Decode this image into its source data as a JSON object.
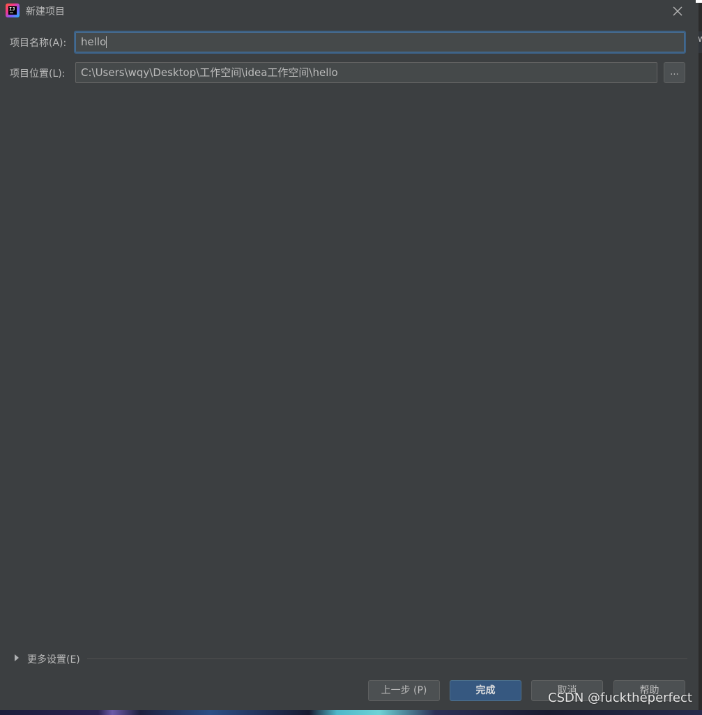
{
  "window": {
    "title": "新建项目",
    "icon": "intellij-idea-icon"
  },
  "form": {
    "name_label": "项目名称(A):",
    "name_value": "hello",
    "location_label": "项目位置(L):",
    "location_value": "C:\\Users\\wqy\\Desktop\\工作空间\\idea工作空间\\hello",
    "browse_label": "..."
  },
  "more_settings": {
    "label": "更多设置(E)",
    "expanded": false
  },
  "buttons": {
    "previous": "上一步 (P)",
    "finish": "完成",
    "cancel": "取消",
    "help": "帮助"
  },
  "watermark": "CSDN @fucktheperfect",
  "colors": {
    "background": "#3c3f41",
    "field_background": "#45494a",
    "focus_border": "#3d6185",
    "primary_button": "#365880",
    "text": "#bbbbbb"
  }
}
